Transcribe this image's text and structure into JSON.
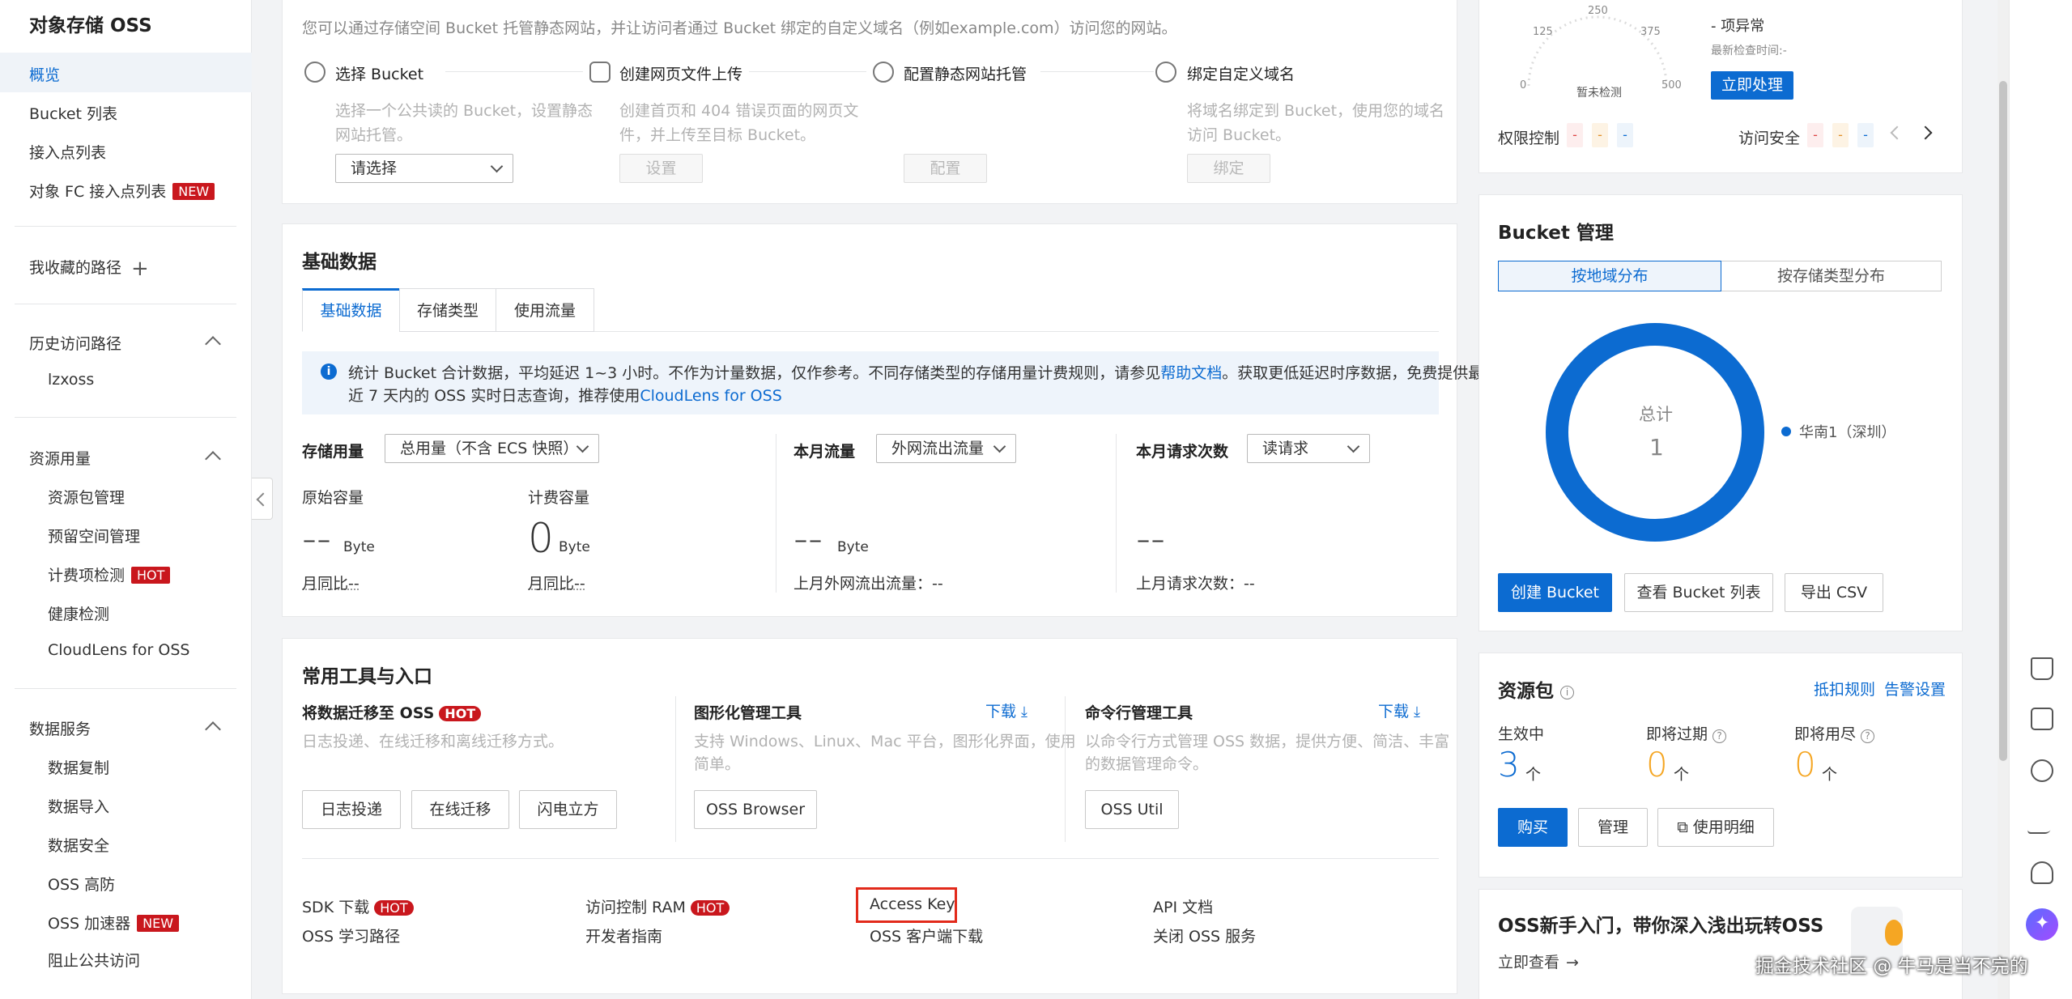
{
  "sidebar": {
    "title": "对象存储 OSS",
    "overview": "概览",
    "bucket_list": "Bucket 列表",
    "access_points": "接入点列表",
    "fc_access_points": "对象 FC 接入点列表",
    "new_tag": "NEW",
    "favorites": "我收藏的路径",
    "history": "历史访问路径",
    "history_item": "lzxoss",
    "resource_usage": "资源用量",
    "resource_pkg": "资源包管理",
    "reserved_space": "预留空间管理",
    "billing_check": "计费项检测",
    "hot_tag": "HOT",
    "health_check": "健康检测",
    "cloudlens": "CloudLens for OSS",
    "data_services": "数据服务",
    "data_copy": "数据复制",
    "data_import": "数据导入",
    "data_security": "数据安全",
    "oss_ddos": "OSS 高防",
    "oss_accel": "OSS 加速器",
    "block_public": "阻止公共访问"
  },
  "website": {
    "desc": "您可以通过存储空间 Bucket 托管静态网站，并让访问者通过 Bucket 绑定的自定义域名（例如example.com）访问您的网站。",
    "steps": [
      {
        "title": "选择 Bucket",
        "desc1": "选择一个公共读的 Bucket，设置静态",
        "desc2": "网站托管。"
      },
      {
        "title": "创建网页文件上传",
        "desc1": "创建首页和 404 错误页面的网页文",
        "desc2": "件，并上传至目标 Bucket。",
        "btn": "设置"
      },
      {
        "title": "配置静态网站托管",
        "btn": "配置"
      },
      {
        "title": "绑定自定义域名",
        "desc1": "将域名绑定到 Bucket，使用您的域名",
        "desc2": "访问 Bucket。",
        "btn": "绑定"
      }
    ],
    "select_placeholder": "请选择"
  },
  "basic_data": {
    "title": "基础数据",
    "tabs": [
      "基础数据",
      "存储类型",
      "使用流量"
    ],
    "info_text1": "统计 Bucket 合计数据，平均延迟 1~3 小时。不作为计量数据，仅作参考。不同存储类型的存储用量计费规则，请参见",
    "info_link1": "帮助文档",
    "info_text2": "。获取更低延迟时序数据，免费提供最",
    "info_text3": "近 7 天内的 OSS 实时日志查询，推荐使用",
    "info_link2": "CloudLens for OSS",
    "storage_label": "存储用量",
    "storage_select": "总用量（不含 ECS 快照）",
    "raw_capacity": "原始容量",
    "raw_value": "--",
    "raw_unit": "Byte",
    "raw_mom": "月同比--",
    "billing_capacity": "计费容量",
    "billing_value": "0",
    "billing_unit": "Byte",
    "billing_mom": "月同比--",
    "traffic_label": "本月流量",
    "traffic_select": "外网流出流量",
    "traffic_value": "--",
    "traffic_unit": "Byte",
    "traffic_last": "上月外网流出流量：--",
    "requests_label": "本月请求次数",
    "requests_select": "读请求",
    "requests_value": "--",
    "requests_last": "上月请求次数：--"
  },
  "tools": {
    "title": "常用工具与入口",
    "migrate_title": "将数据迁移至 OSS",
    "migrate_desc": "日志投递、在线迁移和离线迁移方式。",
    "migrate_btns": [
      "日志投递",
      "在线迁移",
      "闪电立方"
    ],
    "gui_title": "图形化管理工具",
    "gui_download": "下载",
    "gui_desc1": "支持 Windows、Linux、Mac 平台，图形化界面，使用",
    "gui_desc2": "简单。",
    "gui_btn": "OSS Browser",
    "cli_title": "命令行管理工具",
    "cli_download": "下载",
    "cli_desc1": "以命令行方式管理 OSS 数据，提供方便、简洁、丰富",
    "cli_desc2": "的数据管理命令。",
    "cli_btn": "OSS Util",
    "links": {
      "sdk": "SDK 下载",
      "ram": "访问控制 RAM",
      "access_key": "Access Key",
      "api": "API 文档",
      "learn": "OSS 学习路径",
      "dev": "开发者指南",
      "client": "OSS 客户端下载",
      "close": "关闭 OSS 服务"
    }
  },
  "security": {
    "gauge_ticks": [
      "125",
      "250",
      "375",
      "0",
      "500"
    ],
    "gauge_status": "暂未检测",
    "issue_count": "- 项异常",
    "last_check": "最新检查时间:-",
    "handle_btn": "立即处理",
    "perm_label": "权限控制",
    "access_label": "访问安全",
    "dash": "-"
  },
  "bucket_mgmt": {
    "title": "Bucket 管理",
    "tabs": [
      "按地域分布",
      "按存储类型分布"
    ],
    "total_label": "总计",
    "total_value": "1",
    "legend": "华南1（深圳）",
    "create_btn": "创建 Bucket",
    "view_btn": "查看 Bucket 列表",
    "export_btn": "导出 CSV",
    "donut_color": "#0c6bd1"
  },
  "resource_pkg": {
    "title": "资源包",
    "deduct_rule": "抵扣规则",
    "alert_setting": "告警设置",
    "active_label": "生效中",
    "active_value": "3",
    "expiring_label": "即将过期",
    "expiring_value": "0",
    "exhausting_label": "即将用尽",
    "exhausting_value": "0",
    "unit": "个",
    "buy_btn": "购买",
    "manage_btn": "管理",
    "details_btn": "使用明细"
  },
  "newbie": {
    "title": "OSS新手入门，带你深入浅出玩转OSS",
    "link": "立即查看"
  },
  "watermark": "掘金技术社区 @ 牛马是当不完的"
}
